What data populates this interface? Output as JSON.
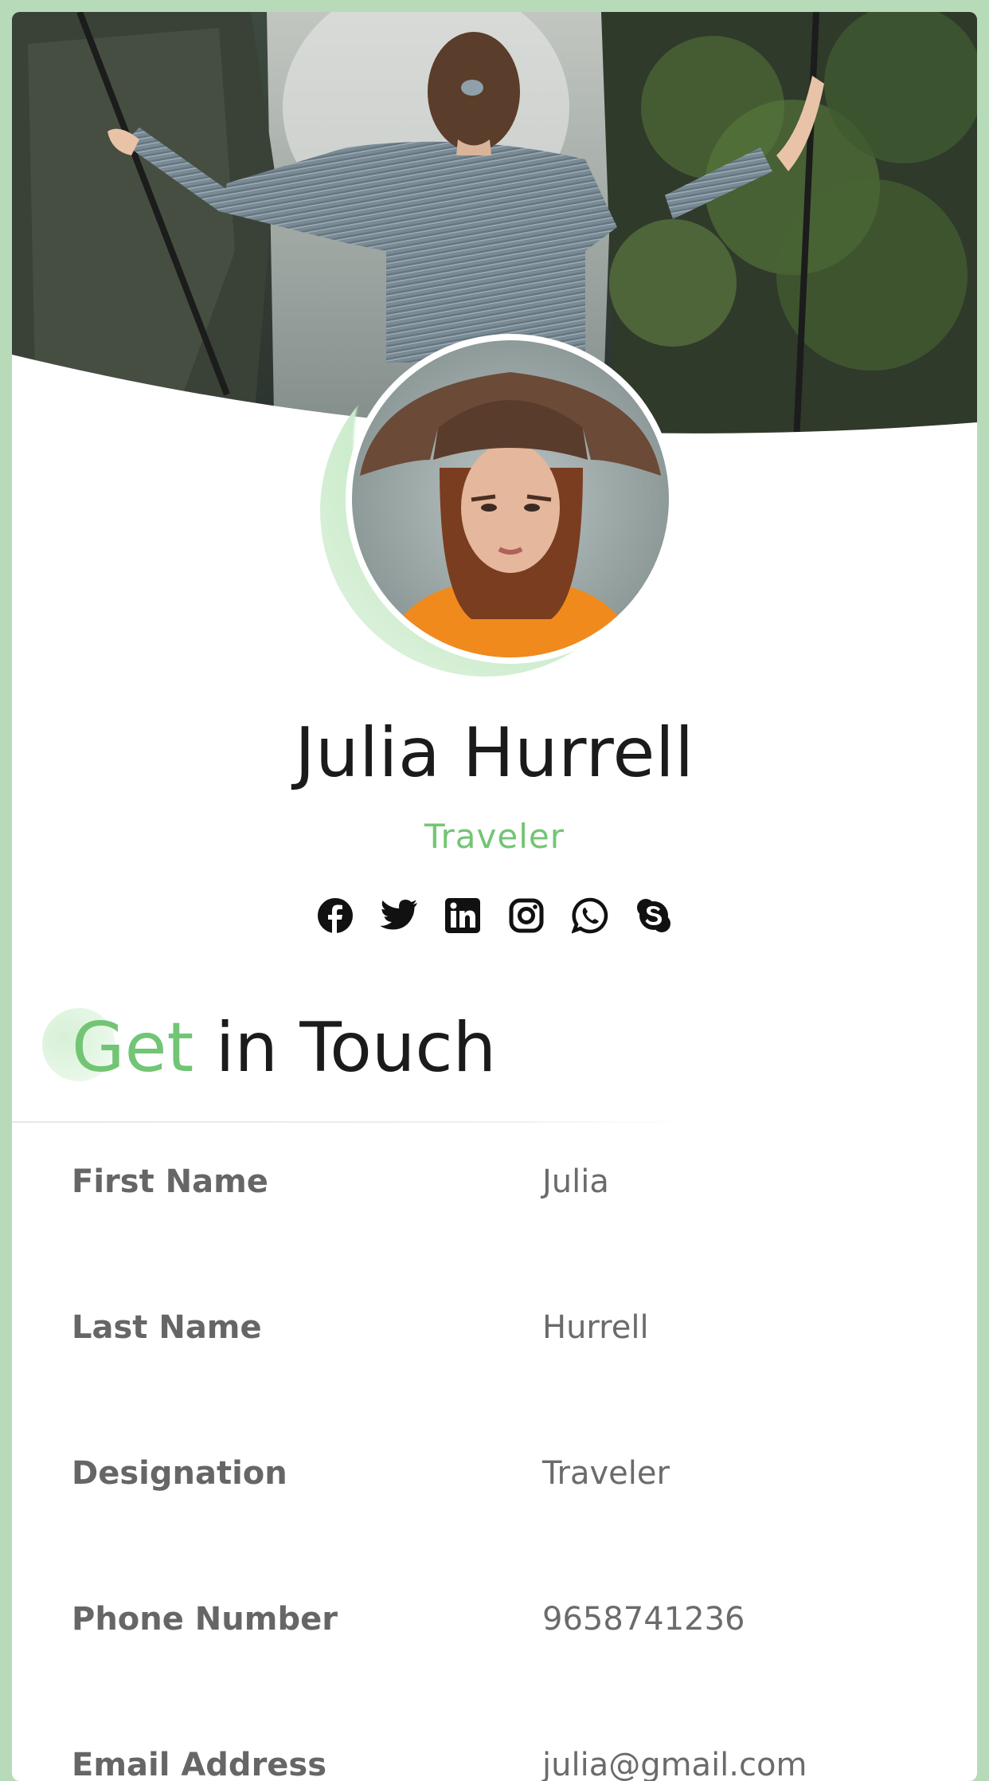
{
  "profile": {
    "name": "Julia Hurrell",
    "role": "Traveler"
  },
  "social_icons": [
    "facebook-icon",
    "twitter-icon",
    "linkedin-icon",
    "instagram-icon",
    "whatsapp-icon",
    "skype-icon"
  ],
  "contact": {
    "heading_accent": "Get",
    "heading_rest": "in Touch",
    "rows": [
      {
        "label": "First Name",
        "value": "Julia"
      },
      {
        "label": "Last Name",
        "value": "Hurrell"
      },
      {
        "label": "Designation",
        "value": "Traveler"
      },
      {
        "label": "Phone Number",
        "value": "9658741236"
      },
      {
        "label": "Email Address",
        "value": "julia@gmail.com"
      }
    ]
  },
  "colors": {
    "accent": "#72c574",
    "frame": "#b7dbb9",
    "text_dark": "#1b1b1b",
    "text_muted": "#666666"
  }
}
